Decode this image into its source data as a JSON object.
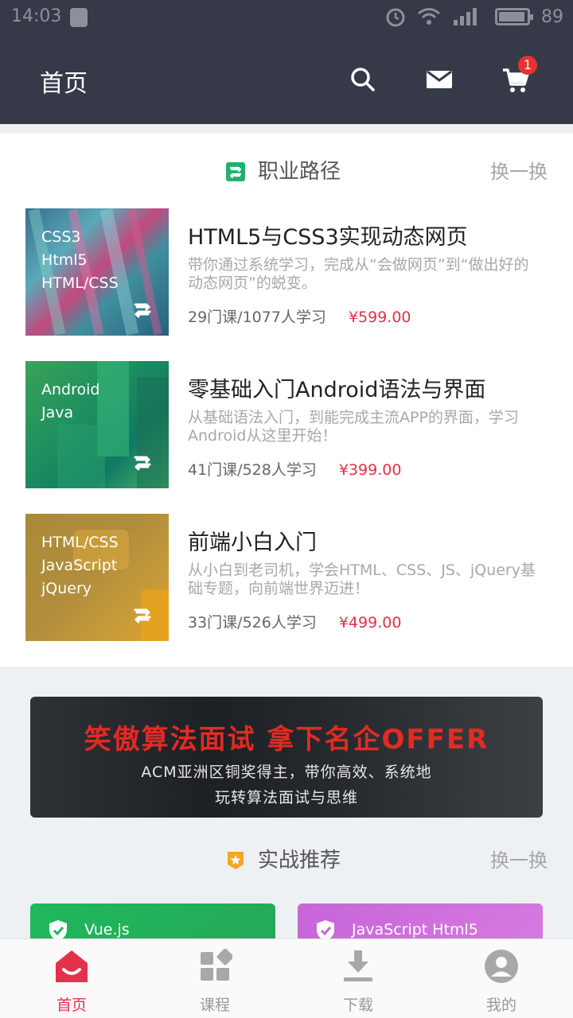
{
  "status_bar": {
    "time": "14:03",
    "battery": "89"
  },
  "header": {
    "title": "首页",
    "cart_badge": "1"
  },
  "career_path": {
    "title": "职业路径",
    "more_label": "换一换",
    "courses": [
      {
        "tags": [
          "CSS3",
          "Html5",
          "HTML/CSS"
        ],
        "title": "HTML5与CSS3实现动态网页",
        "desc": "带你通过系统学习，完成从“会做网页”到“做出好的动态网页”的蜕变。",
        "meta": "29门课/1077人学习",
        "price": "¥599.00"
      },
      {
        "tags": [
          "Android",
          "Java"
        ],
        "title": "零基础入门Android语法与界面",
        "desc": "从基础语法入门，到能完成主流APP的界面，学习Android从这里开始！",
        "meta": "41门课/528人学习",
        "price": "¥399.00"
      },
      {
        "tags": [
          "HTML/CSS",
          "JavaScript",
          "jQuery"
        ],
        "title": "前端小白入门",
        "desc": "从小白到老司机，学会HTML、CSS、JS、jQuery基础专题，向前端世界迈进！",
        "meta": "33门课/526人学习",
        "price": "¥499.00"
      }
    ]
  },
  "banner": {
    "headline": "笑傲算法面试 拿下名企OFFER",
    "line1": "ACM亚洲区铜奖得主，带你高效、系统地",
    "line2": "玩转算法面试与思维"
  },
  "practical": {
    "title": "实战推荐",
    "more_label": "换一换",
    "cards": [
      {
        "label": "Vue.js"
      },
      {
        "label": "JavaScript    Html5"
      }
    ]
  },
  "bottom_nav": [
    {
      "label": "首页",
      "icon": "home-icon"
    },
    {
      "label": "课程",
      "icon": "courses-icon"
    },
    {
      "label": "下载",
      "icon": "download-icon"
    },
    {
      "label": "我的",
      "icon": "profile-icon"
    }
  ],
  "colors": {
    "accent": "#e5304b",
    "header_bg": "#363a48",
    "path_green": "#1fb26e",
    "star_orange": "#f6a623"
  }
}
